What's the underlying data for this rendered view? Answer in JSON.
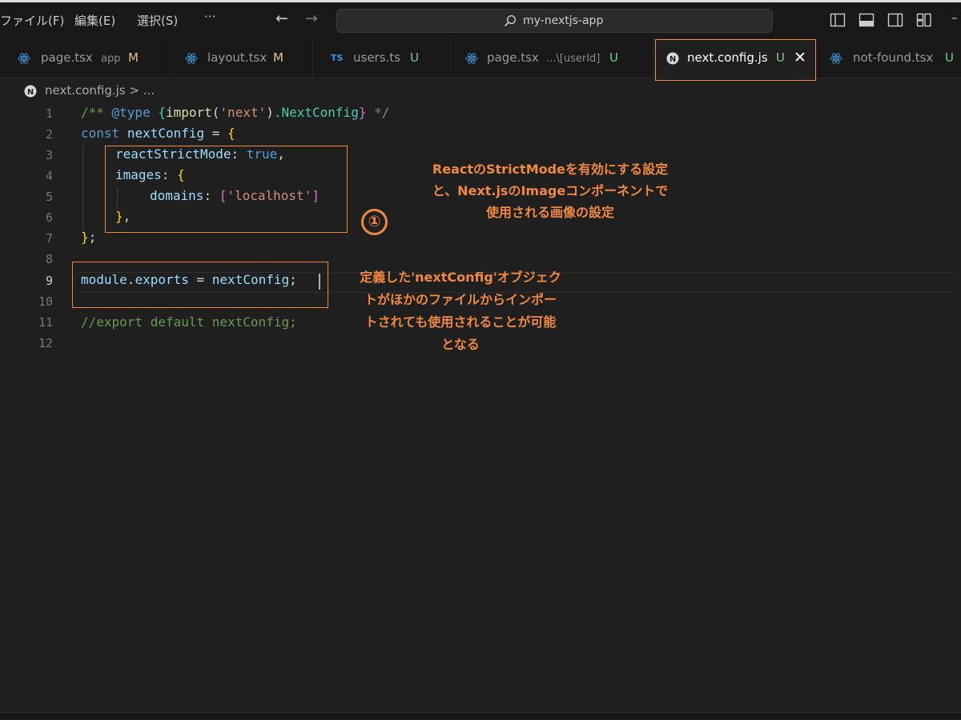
{
  "menu": {
    "file": "ファイル(F)",
    "edit": "編集(E)",
    "selection": "選択(S)",
    "more": "···"
  },
  "titlebar": {
    "back_arrow": "←",
    "forward_arrow": "→",
    "search_text": "my-nextjs-app",
    "overflow": "–"
  },
  "tabs": [
    {
      "name": "page.tsx",
      "sub": "app",
      "status": "M",
      "icon": "react-icon"
    },
    {
      "name": "layout.tsx",
      "sub": "",
      "status": "M",
      "icon": "react-icon"
    },
    {
      "name": "users.ts",
      "sub": "",
      "status": "U",
      "icon": "ts-icon",
      "icon_text": "TS"
    },
    {
      "name": "page.tsx",
      "sub": "...\\[userId]",
      "status": "U",
      "icon": "react-icon"
    },
    {
      "name": "next.config.js",
      "sub": "",
      "status": "U",
      "icon": "nextjs-icon",
      "close": "✕",
      "active": true
    },
    {
      "name": "not-found.tsx",
      "sub": "",
      "status": "U",
      "icon": "react-icon"
    }
  ],
  "breadcrumb": {
    "text": "next.config.js > ..."
  },
  "editor": {
    "line_numbers": [
      "1",
      "2",
      "3",
      "4",
      "5",
      "6",
      "7",
      "8",
      "9",
      "10",
      "11",
      "12"
    ],
    "current_line": "9",
    "code": {
      "l1": {
        "a": "/** ",
        "b": "@type",
        "c": " ",
        "d": "{",
        "e": "import",
        "f": "(",
        "g": "'next'",
        "h": ")",
        "i": ".NextConfig",
        "j": "}",
        "k": " */"
      },
      "l2": {
        "a": "const",
        "b": " ",
        "c": "nextConfig",
        "d": " = ",
        "e": "{"
      },
      "l3": {
        "a": "reactStrictMode",
        "b": ": ",
        "c": "true",
        "d": ","
      },
      "l4": {
        "a": "images",
        "b": ": ",
        "c": "{"
      },
      "l5": {
        "a": "domains",
        "b": ": ",
        "c": "[",
        "d": "'localhost'",
        "e": "]"
      },
      "l6": {
        "a": "}",
        "b": ","
      },
      "l7": {
        "a": "}",
        "b": ";"
      },
      "l9": {
        "a": "module",
        "b": ".",
        "c": "exports",
        "d": " = ",
        "e": "nextConfig",
        "f": ";"
      },
      "l11": {
        "a": "//export default nextConfig;"
      }
    }
  },
  "annotations": {
    "note1": [
      "ReactのStrictModeを有効にする設定",
      "と、Next.jsのImageコンポーネントで",
      "使用される画像の設定"
    ],
    "circle": "①",
    "note2": [
      "定義した'nextConfig'オブジェク",
      "トがほかのファイルからインポー",
      "トされても使用されることが可能",
      "となる"
    ],
    "accent_color": "#f0883e"
  }
}
